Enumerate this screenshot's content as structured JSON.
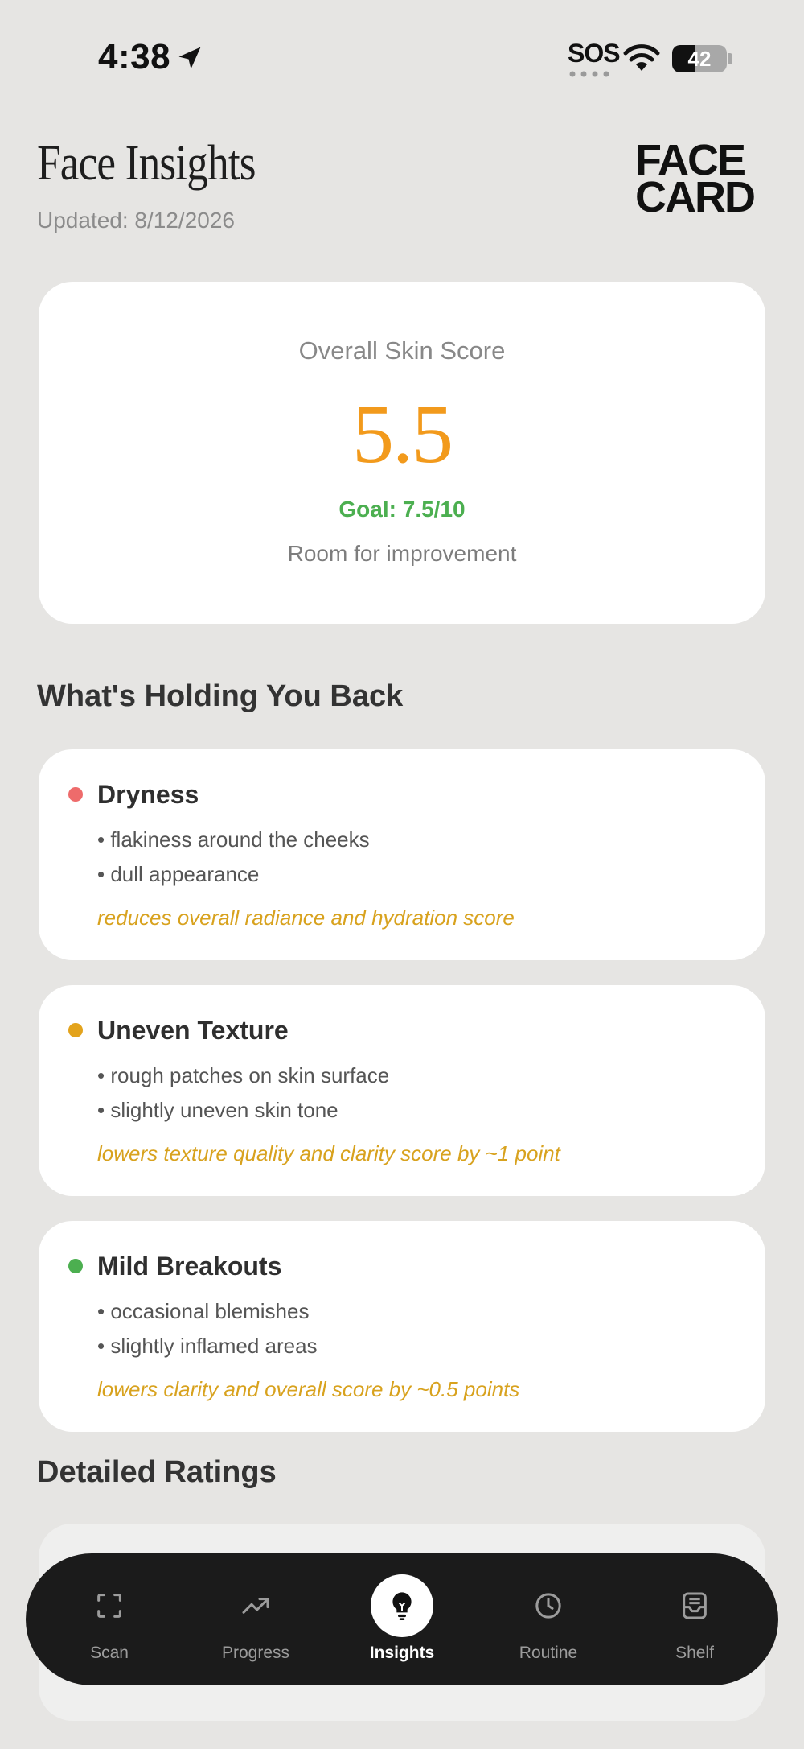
{
  "status_bar": {
    "time": "4:38",
    "carrier": "SOS",
    "battery": "42",
    "battery_level": 0.42
  },
  "header": {
    "title": "Face Insights",
    "updated": "Updated: 8/12/2026",
    "logo_line1": "FACE",
    "logo_line2": "CARD"
  },
  "score_card": {
    "label": "Overall Skin Score",
    "value": "5.5",
    "goal": "Goal: 7.5/10",
    "note": "Room for improvement"
  },
  "holding_back": {
    "title": "What's Holding You Back",
    "issues": [
      {
        "title": "Dryness",
        "bullets": [
          "• flakiness around the cheeks",
          "• dull appearance"
        ],
        "impact": "reduces overall radiance and hydration score",
        "color": "#ee6b6b"
      },
      {
        "title": "Uneven Texture",
        "bullets": [
          "• rough patches on skin surface",
          "• slightly uneven skin tone"
        ],
        "impact": "lowers texture quality and clarity score by ~1 point",
        "color": "#e3a31c"
      },
      {
        "title": "Mild Breakouts",
        "bullets": [
          "• occasional blemishes",
          "• slightly inflamed areas"
        ],
        "impact": "lowers clarity and overall score by ~0.5 points",
        "color": "#4caf50"
      }
    ]
  },
  "ratings": {
    "title": "Detailed Ratings"
  },
  "tabbar": {
    "tabs": [
      {
        "label": "Scan",
        "icon": "scan-icon"
      },
      {
        "label": "Progress",
        "icon": "trend-icon"
      },
      {
        "label": "Insights",
        "icon": "lightbulb-icon",
        "active": true
      },
      {
        "label": "Routine",
        "icon": "clock-icon"
      },
      {
        "label": "Shelf",
        "icon": "tray-icon"
      }
    ]
  },
  "colors": {
    "background": "#e6e5e3",
    "score": "#f29a1c",
    "goal": "#4caf50",
    "impact": "#d8a21e",
    "tabbar": "#1b1b1b"
  }
}
